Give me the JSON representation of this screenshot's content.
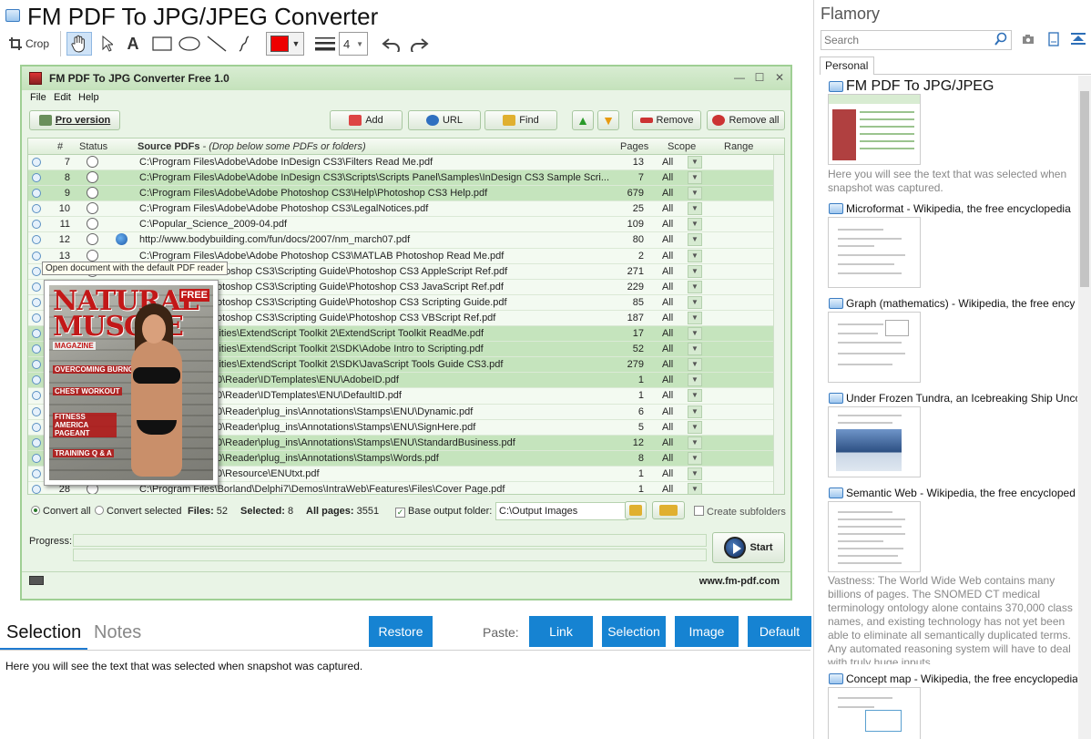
{
  "window": {
    "title": "FM PDF To JPG/JPEG Converter"
  },
  "toolbar": {
    "crop_label": "Crop",
    "line_width_value": "4",
    "color": "#ee0000"
  },
  "app": {
    "title": "FM PDF To JPG Converter Free 1.0",
    "menu": [
      "File",
      "Edit",
      "Help"
    ],
    "buttons": {
      "pro": "Pro version",
      "add": "Add",
      "url": "URL",
      "find": "Find",
      "remove": "Remove",
      "remove_all": "Remove all"
    },
    "columns": {
      "num": "#",
      "status": "Status",
      "source": "Source PDFs",
      "source_hint": " - (Drop below some PDFs or folders)",
      "pages": "Pages",
      "scope": "Scope",
      "range": "Range"
    },
    "rows": [
      {
        "n": "7",
        "path": "C:\\Program Files\\Adobe\\Adobe InDesign CS3\\Filters Read Me.pdf",
        "pages": "13",
        "scope": "All",
        "hl": false,
        "web": false
      },
      {
        "n": "8",
        "path": "C:\\Program Files\\Adobe\\Adobe InDesign CS3\\Scripts\\Scripts Panel\\Samples\\InDesign CS3 Sample Scri...",
        "pages": "7",
        "scope": "All",
        "hl": true,
        "web": false
      },
      {
        "n": "9",
        "path": "C:\\Program Files\\Adobe\\Adobe Photoshop CS3\\Help\\Photoshop CS3 Help.pdf",
        "pages": "679",
        "scope": "All",
        "hl": true,
        "web": false
      },
      {
        "n": "10",
        "path": "C:\\Program Files\\Adobe\\Adobe Photoshop CS3\\LegalNotices.pdf",
        "pages": "25",
        "scope": "All",
        "hl": false,
        "web": false
      },
      {
        "n": "11",
        "path": "C:\\Popular_Science_2009-04.pdf",
        "pages": "109",
        "scope": "All",
        "hl": false,
        "web": false
      },
      {
        "n": "12",
        "path": "http://www.bodybuilding.com/fun/docs/2007/nm_march07.pdf",
        "pages": "80",
        "scope": "All",
        "hl": false,
        "web": true
      },
      {
        "n": "13",
        "path": "C:\\Program Files\\Adobe\\Adobe Photoshop CS3\\MATLAB Photoshop Read Me.pdf",
        "pages": "2",
        "scope": "All",
        "hl": false,
        "web": false
      },
      {
        "n": "",
        "path": "...dobe\\Adobe Photoshop CS3\\Scripting Guide\\Photoshop CS3 AppleScript Ref.pdf",
        "pages": "271",
        "scope": "All",
        "hl": false,
        "web": false
      },
      {
        "n": "",
        "path": "...dobe\\Adobe Photoshop CS3\\Scripting Guide\\Photoshop CS3 JavaScript Ref.pdf",
        "pages": "229",
        "scope": "All",
        "hl": false,
        "web": false
      },
      {
        "n": "",
        "path": "...dobe\\Adobe Photoshop CS3\\Scripting Guide\\Photoshop CS3 Scripting Guide.pdf",
        "pages": "85",
        "scope": "All",
        "hl": false,
        "web": false
      },
      {
        "n": "",
        "path": "...dobe\\Adobe Photoshop CS3\\Scripting Guide\\Photoshop CS3 VBScript Ref.pdf",
        "pages": "187",
        "scope": "All",
        "hl": false,
        "web": false
      },
      {
        "n": "",
        "path": "...dobe\\Adobe Utilities\\ExtendScript Toolkit 2\\ExtendScript Toolkit ReadMe.pdf",
        "pages": "17",
        "scope": "All",
        "hl": true,
        "web": false
      },
      {
        "n": "",
        "path": "...dobe\\Adobe Utilities\\ExtendScript Toolkit 2\\SDK\\Adobe Intro to Scripting.pdf",
        "pages": "52",
        "scope": "All",
        "hl": true,
        "web": false
      },
      {
        "n": "",
        "path": "...dobe\\Adobe Utilities\\ExtendScript Toolkit 2\\SDK\\JavaScript Tools Guide CS3.pdf",
        "pages": "279",
        "scope": "All",
        "hl": true,
        "web": false
      },
      {
        "n": "",
        "path": "...dobe\\Reader 8.0\\Reader\\IDTemplates\\ENU\\AdobeID.pdf",
        "pages": "1",
        "scope": "All",
        "hl": true,
        "web": false
      },
      {
        "n": "",
        "path": "...dobe\\Reader 8.0\\Reader\\IDTemplates\\ENU\\DefaultID.pdf",
        "pages": "1",
        "scope": "All",
        "hl": false,
        "web": false
      },
      {
        "n": "",
        "path": "...dobe\\Reader 8.0\\Reader\\plug_ins\\Annotations\\Stamps\\ENU\\Dynamic.pdf",
        "pages": "6",
        "scope": "All",
        "hl": false,
        "web": false
      },
      {
        "n": "",
        "path": "...dobe\\Reader 8.0\\Reader\\plug_ins\\Annotations\\Stamps\\ENU\\SignHere.pdf",
        "pages": "5",
        "scope": "All",
        "hl": false,
        "web": false
      },
      {
        "n": "",
        "path": "...dobe\\Reader 8.0\\Reader\\plug_ins\\Annotations\\Stamps\\ENU\\StandardBusiness.pdf",
        "pages": "12",
        "scope": "All",
        "hl": true,
        "web": false
      },
      {
        "n": "",
        "path": "...dobe\\Reader 8.0\\Reader\\plug_ins\\Annotations\\Stamps\\Words.pdf",
        "pages": "8",
        "scope": "All",
        "hl": true,
        "web": false
      },
      {
        "n": "",
        "path": "...dobe\\Reader 8.0\\Resource\\ENUtxt.pdf",
        "pages": "1",
        "scope": "All",
        "hl": false,
        "web": false
      },
      {
        "n": "28",
        "path": "C:\\Program Files\\Borland\\Delphi7\\Demos\\IntraWeb\\Features\\Files\\Cover Page.pdf",
        "pages": "1",
        "scope": "All",
        "hl": false,
        "web": false
      }
    ],
    "tooltip": "Open document with the default PDF reader",
    "magazine": {
      "masthead": "NATURAL MUSCLE",
      "sub": "MAGAZINE",
      "free": "FREE",
      "lines": [
        "OVERCOMING BURNOUT",
        "CHEST WORKOUT",
        "FITNESS AMERICA PAGEANT",
        "TRAINING Q & A"
      ]
    },
    "options": {
      "convert_all": "Convert all",
      "convert_selected": "Convert selected",
      "files_label": "Files:",
      "files_value": "52",
      "selected_label": "Selected:",
      "selected_value": "8",
      "allpages_label": "All pages:",
      "allpages_value": "3551",
      "base_output": "Base output folder:",
      "output_path": "C:\\Output Images",
      "create_subfolders": "Create subfolders"
    },
    "progress_label": "Progress:",
    "start_label": "Start",
    "website": "www.fm-pdf.com"
  },
  "lower": {
    "tab_selection": "Selection",
    "tab_notes": "Notes",
    "restore": "Restore",
    "paste_label": "Paste:",
    "paste_link": "Link",
    "paste_selection": "Selection",
    "paste_image": "Image",
    "paste_default": "Default",
    "selection_text": "Here you will see the text that was selected when snapshot was captured."
  },
  "right": {
    "app_name": "Flamory",
    "search_placeholder": "Search",
    "tab_personal": "Personal",
    "entries": [
      {
        "title": "FM PDF To JPG/JPEG",
        "desc": "Here you will see the text that was selected when snapshot was captured."
      },
      {
        "title": "Microformat - Wikipedia, the free encyclopedia",
        "desc": ""
      },
      {
        "title": "Graph (mathematics) - Wikipedia, the free ency",
        "desc": ""
      },
      {
        "title": "Under Frozen Tundra, an Icebreaking Ship Unco",
        "desc": ""
      },
      {
        "title": "Semantic Web - Wikipedia, the free encycloped",
        "desc": "Vastness: The World Wide Web contains many billions of pages. The SNOMED CT medical terminology ontology alone contains 370,000 class names, and existing technology has not yet been able to eliminate all semantically duplicated terms. Any automated reasoning system will have to deal with truly huge inputs."
      },
      {
        "title": "Concept map - Wikipedia, the free encyclopedia",
        "desc": ""
      }
    ]
  }
}
